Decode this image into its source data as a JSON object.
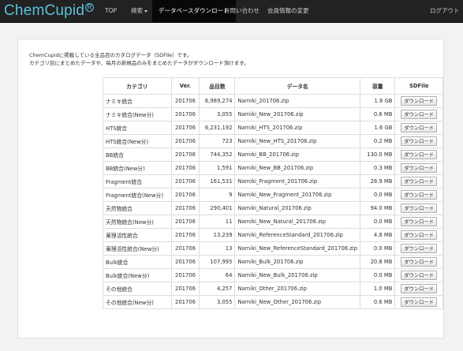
{
  "nav": {
    "logo": "ChemCupid",
    "registered": "R",
    "top": "TOP",
    "search": "検索",
    "download": "データベースダウンロード",
    "contact": "お問い合わせ",
    "member_change": "会員情報の変更",
    "logout": "ログアウト"
  },
  "intro": {
    "line1": "ChemCupidに掲載している全品目のカタログデータ（SDFile）です。",
    "line2": "カテゴリ別にまとめたデータや、毎月の新規品のみをまとめたデータがダウンロード頂けます。"
  },
  "table": {
    "headers": [
      "カテゴリ",
      "Ver.",
      "品目数",
      "データ名",
      "容量",
      "SDFile"
    ],
    "button_label": "ダウンロード",
    "rows": [
      [
        "ナミキ統合",
        "201706",
        "6,989,274",
        "Namiki_201706.zip",
        "1.8 GB"
      ],
      [
        "ナミキ統合(New分)",
        "201706",
        "3,055",
        "Namiki_New_201706.zip",
        "0.6 MB"
      ],
      [
        "HTS統合",
        "201706",
        "6,231,192",
        "Namiki_HTS_201706.zip",
        "1.6 GB"
      ],
      [
        "HTS統合(New分)",
        "201706",
        "723",
        "Namiki_New_HTS_201706.zip",
        "0.2 MB"
      ],
      [
        "BB統合",
        "201706",
        "744,352",
        "Namiki_BB_201706.zip",
        "130.0 MB"
      ],
      [
        "BB統合(New分)",
        "201706",
        "1,591",
        "Namiki_New_BB_201706.zip",
        "0.3 MB"
      ],
      [
        "Fragment統合",
        "201706",
        "161,531",
        "Namiki_Fragment_201706.zip",
        "28.9 MB"
      ],
      [
        "Fragment統合(New分)",
        "201706",
        "9",
        "Namiki_New_Fragment_201706.zip",
        "0.0 MB"
      ],
      [
        "天然物統合",
        "201706",
        "290,401",
        "Namiki_Natural_201706.zip",
        "94.0 MB"
      ],
      [
        "天然物統合(New分)",
        "201706",
        "11",
        "Namiki_New_Natural_201706.zip",
        "0.0 MB"
      ],
      [
        "薬理活性統合",
        "201706",
        "13,239",
        "Namiki_ReferenceStandard_201706.zip",
        "4.8 MB"
      ],
      [
        "薬理活性統合(New分)",
        "201706",
        "13",
        "Namiki_New_ReferenceStandard_201706.zip",
        "0.0 MB"
      ],
      [
        "Bulk統合",
        "201706",
        "107,995",
        "Namiki_Bulk_201706.zip",
        "20.8 MB"
      ],
      [
        "Bulk統合(New分)",
        "201706",
        "64",
        "Namiki_New_Bulk_201706.zip",
        "0.0 MB"
      ],
      [
        "その他統合",
        "201706",
        "4,257",
        "Namiki_Other_201706.zip",
        "1.0 MB"
      ],
      [
        "その他統合(New分)",
        "201706",
        "3,055",
        "Namiki_New_Other_201706.zip",
        "0.6 MB"
      ]
    ]
  }
}
